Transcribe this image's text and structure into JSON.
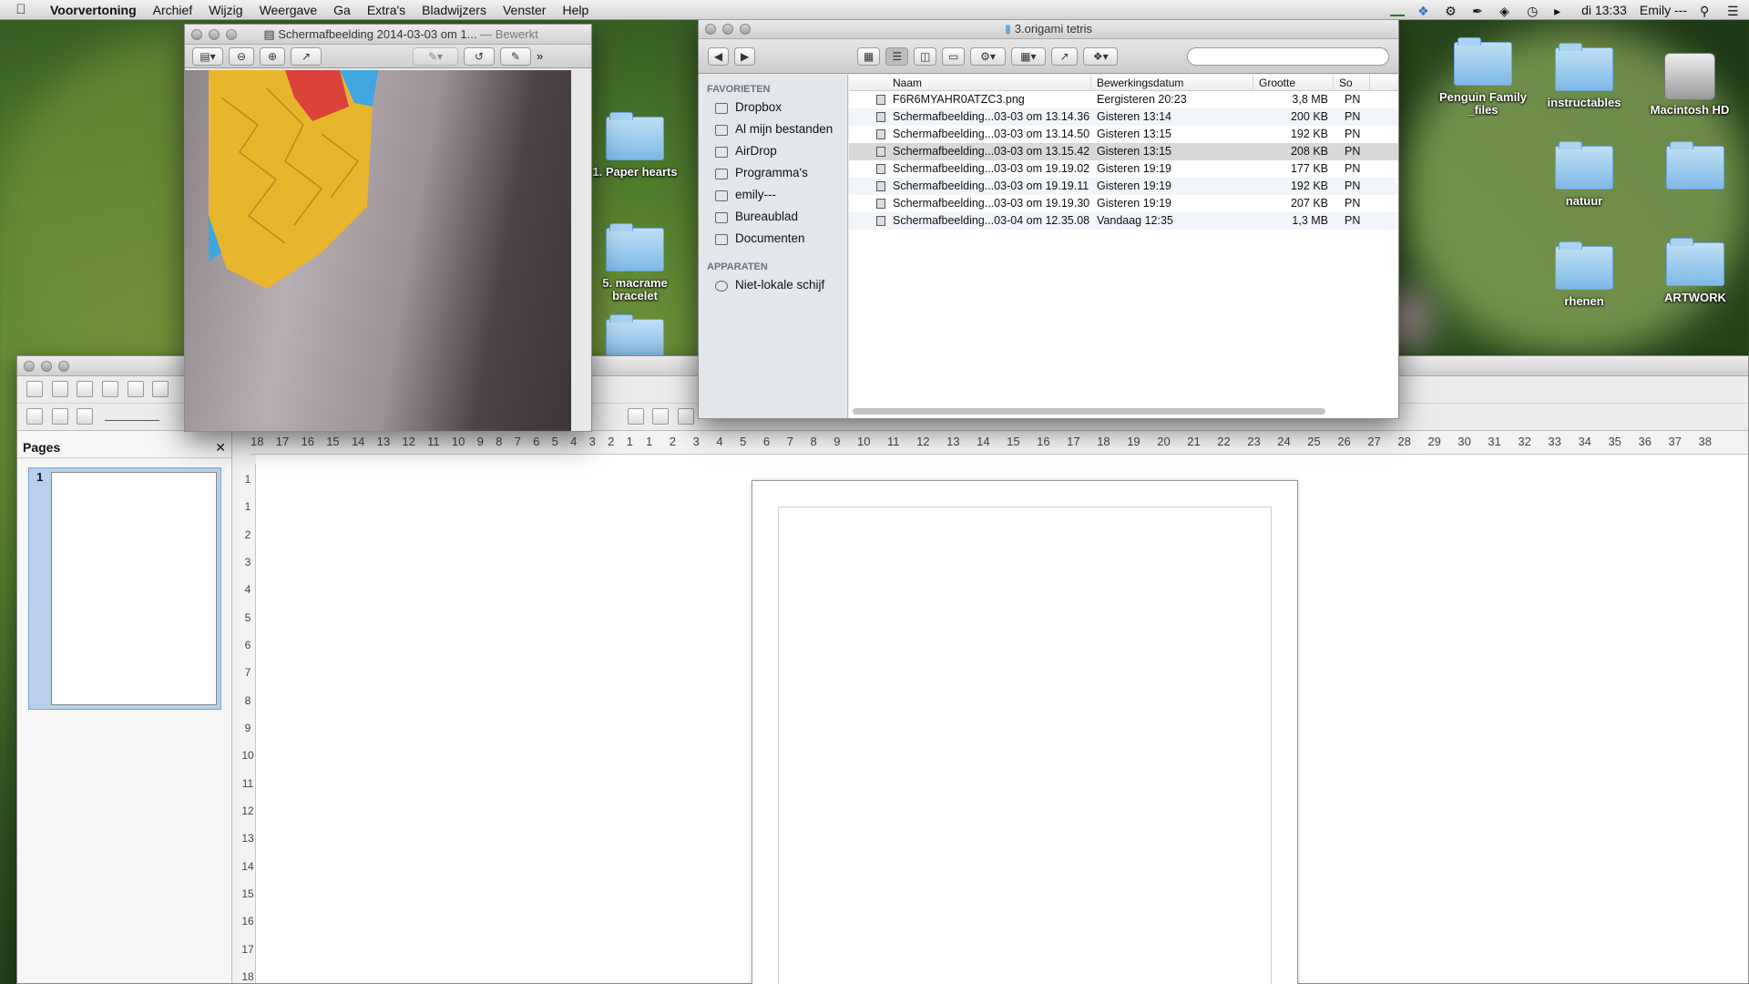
{
  "menubar": {
    "app": "Voorvertoning",
    "items": [
      "Archief",
      "Wijzig",
      "Weergave",
      "Ga",
      "Extra's",
      "Bladwijzers",
      "Venster",
      "Help"
    ],
    "clock": "di 13:33",
    "user": "Emily ---"
  },
  "desktop": {
    "icons": [
      {
        "label": "1. Paper hearts"
      },
      {
        "label": "5. macrame bracelet"
      },
      {
        "label": "Penguin Family _files"
      },
      {
        "label": "instructables"
      },
      {
        "label": "Macintosh HD"
      },
      {
        "label": "natuur"
      },
      {
        "label": "rhenen"
      },
      {
        "label": "ARTWORK"
      }
    ]
  },
  "preview": {
    "title": "Schermafbeelding 2014-03-03 om 1...",
    "edited": "— Bewerkt"
  },
  "finder": {
    "title": "3.origami tetris",
    "search_placeholder": "",
    "sidebar": {
      "favorites_header": "FAVORIETEN",
      "favorites": [
        "Dropbox",
        "Al mijn bestanden",
        "AirDrop",
        "Programma's",
        "emily---",
        "Bureaublad",
        "Documenten"
      ],
      "devices_header": "APPARATEN",
      "devices": [
        "Niet-lokale schijf"
      ]
    },
    "columns": [
      "Naam",
      "Bewerkingsdatum",
      "Grootte",
      "So"
    ],
    "rows": [
      {
        "name": "F6R6MYAHR0ATZC3.png",
        "date": "Eergisteren 20:23",
        "size": "3,8 MB",
        "kind": "PN"
      },
      {
        "name": "Schermafbeelding...03-03 om 13.14.36",
        "date": "Gisteren 13:14",
        "size": "200 KB",
        "kind": "PN"
      },
      {
        "name": "Schermafbeelding...03-03 om 13.14.50",
        "date": "Gisteren 13:15",
        "size": "192 KB",
        "kind": "PN"
      },
      {
        "name": "Schermafbeelding...03-03 om 13.15.42",
        "date": "Gisteren 13:15",
        "size": "208 KB",
        "kind": "PN"
      },
      {
        "name": "Schermafbeelding...03-03 om 19.19.02",
        "date": "Gisteren 19:19",
        "size": "177 KB",
        "kind": "PN"
      },
      {
        "name": "Schermafbeelding...03-03 om 19.19.11",
        "date": "Gisteren 19:19",
        "size": "192 KB",
        "kind": "PN"
      },
      {
        "name": "Schermafbeelding...03-03 om 19.19.30",
        "date": "Gisteren 19:19",
        "size": "207 KB",
        "kind": "PN"
      },
      {
        "name": "Schermafbeelding...03-04 om 12.35.08",
        "date": "Vandaag 12:35",
        "size": "1,3 MB",
        "kind": "PN"
      }
    ]
  },
  "writer": {
    "pages_title": "Pages",
    "page_number": "1",
    "hruler_left": [
      "18",
      "17",
      "16",
      "15",
      "14",
      "13",
      "12",
      "11",
      "10",
      "9",
      "8",
      "7",
      "6",
      "5",
      "4",
      "3",
      "2",
      "1"
    ],
    "hruler_right": [
      "1",
      "2",
      "3",
      "4",
      "5",
      "6",
      "7",
      "8",
      "9",
      "10",
      "11",
      "12",
      "13",
      "14",
      "15",
      "16",
      "17",
      "18",
      "19",
      "20",
      "21",
      "22",
      "23",
      "24",
      "25",
      "26",
      "27",
      "28",
      "29",
      "30",
      "31",
      "32",
      "33",
      "34",
      "35",
      "36",
      "37",
      "38"
    ],
    "vruler": [
      "1",
      "1",
      "2",
      "3",
      "4",
      "5",
      "6",
      "7",
      "8",
      "9",
      "10",
      "11",
      "12",
      "13",
      "14",
      "15",
      "16",
      "17",
      "18"
    ]
  }
}
